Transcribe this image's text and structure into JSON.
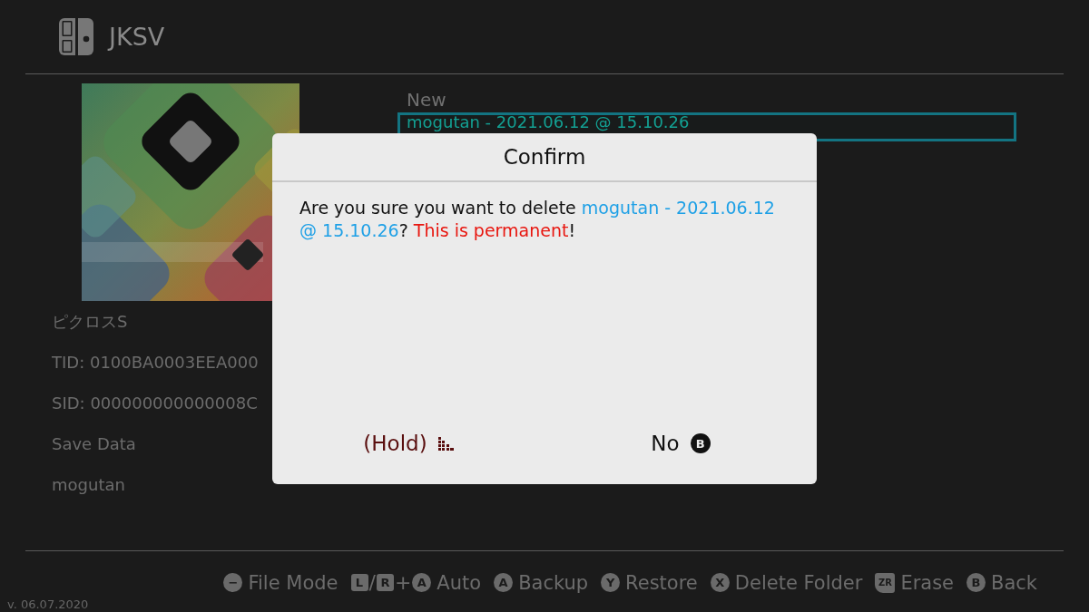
{
  "header": {
    "title": "JKSV"
  },
  "info": [
    "ピクロスS",
    "TID: 0100BA0003EEA000",
    "SID: 000000000000008C",
    "Save Data",
    "mogutan"
  ],
  "saves": [
    {
      "label": "New",
      "selected": false
    },
    {
      "label": "mogutan - 2021.06.12 @ 15.10.26",
      "selected": true
    }
  ],
  "dialog": {
    "title": "Confirm",
    "message": [
      {
        "kind": "plain",
        "text": "Are you sure you want to delete "
      },
      {
        "kind": "highlight",
        "text": "mogutan - 2021.06.12 @ 15.10.26"
      },
      {
        "kind": "plain",
        "text": "? "
      },
      {
        "kind": "warning",
        "text": "This is permanent"
      },
      {
        "kind": "plain",
        "text": "!"
      }
    ],
    "buttons": [
      {
        "label": "(Hold)",
        "kind": "hold"
      },
      {
        "label": "No",
        "kind": "plain",
        "glyph": "B"
      }
    ]
  },
  "hints": [
    {
      "label": "File Mode",
      "keys": [
        {
          "kind": "circle",
          "text": "−"
        }
      ]
    },
    {
      "label": "Auto",
      "keys": [
        {
          "kind": "square",
          "text": "L"
        },
        {
          "kind": "sep",
          "text": "/"
        },
        {
          "kind": "square",
          "text": "R"
        },
        {
          "kind": "sep",
          "text": "+"
        },
        {
          "kind": "circle",
          "text": "A"
        }
      ]
    },
    {
      "label": "Backup",
      "keys": [
        {
          "kind": "circle",
          "text": "A"
        }
      ]
    },
    {
      "label": "Restore",
      "keys": [
        {
          "kind": "circle",
          "text": "Y"
        }
      ]
    },
    {
      "label": "Delete Folder",
      "keys": [
        {
          "kind": "circle",
          "text": "X"
        }
      ]
    },
    {
      "label": "Erase",
      "keys": [
        {
          "kind": "trigger",
          "text": "ZR"
        }
      ]
    },
    {
      "label": "Back",
      "keys": [
        {
          "kind": "circle",
          "text": "B"
        }
      ]
    }
  ],
  "version": "v. 06.07.2020"
}
